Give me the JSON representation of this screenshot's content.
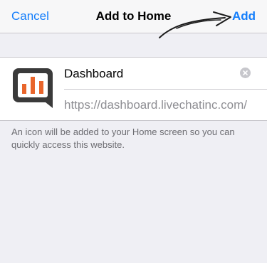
{
  "navbar": {
    "cancel_label": "Cancel",
    "title": "Add to Home",
    "add_label": "Add"
  },
  "colors": {
    "accent": "#147efb",
    "icon_frame": "#3a3a3a",
    "icon_bars": "#e9652b",
    "background": "#efeff4"
  },
  "bookmark": {
    "icon": "livechat-dashboard-app-icon",
    "name_value": "Dashboard",
    "url": "https://dashboard.livechatinc.com/",
    "clear_icon": "clear-circle-x-icon"
  },
  "footer": {
    "info_text": "An icon will be added to your Home screen so you can quickly access this website."
  }
}
